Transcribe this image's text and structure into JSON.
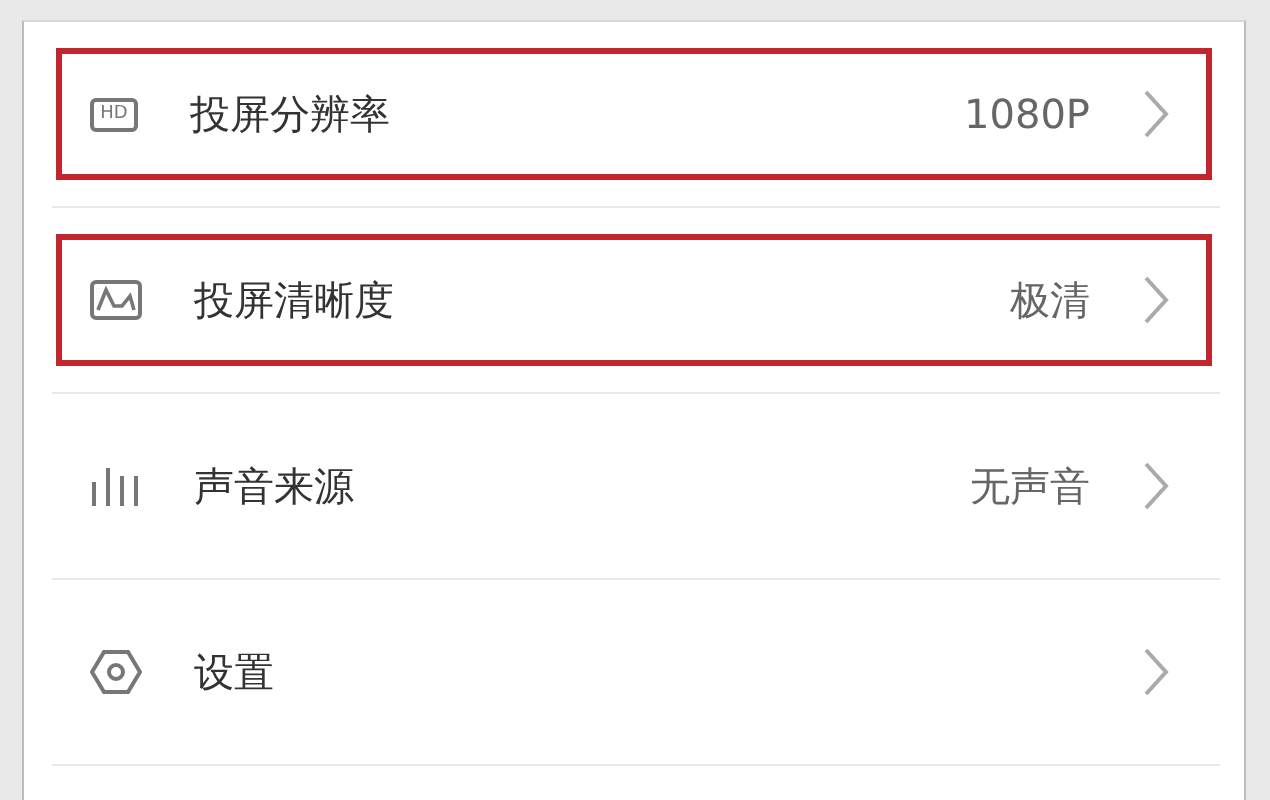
{
  "items": [
    {
      "icon_text": "HD",
      "label": "投屏分辨率",
      "value": "1080P",
      "highlighted": true
    },
    {
      "label": "投屏清晰度",
      "value": "极清",
      "highlighted": true
    },
    {
      "label": "声音来源",
      "value": "无声音",
      "highlighted": false
    },
    {
      "label": "设置",
      "highlighted": false
    }
  ]
}
